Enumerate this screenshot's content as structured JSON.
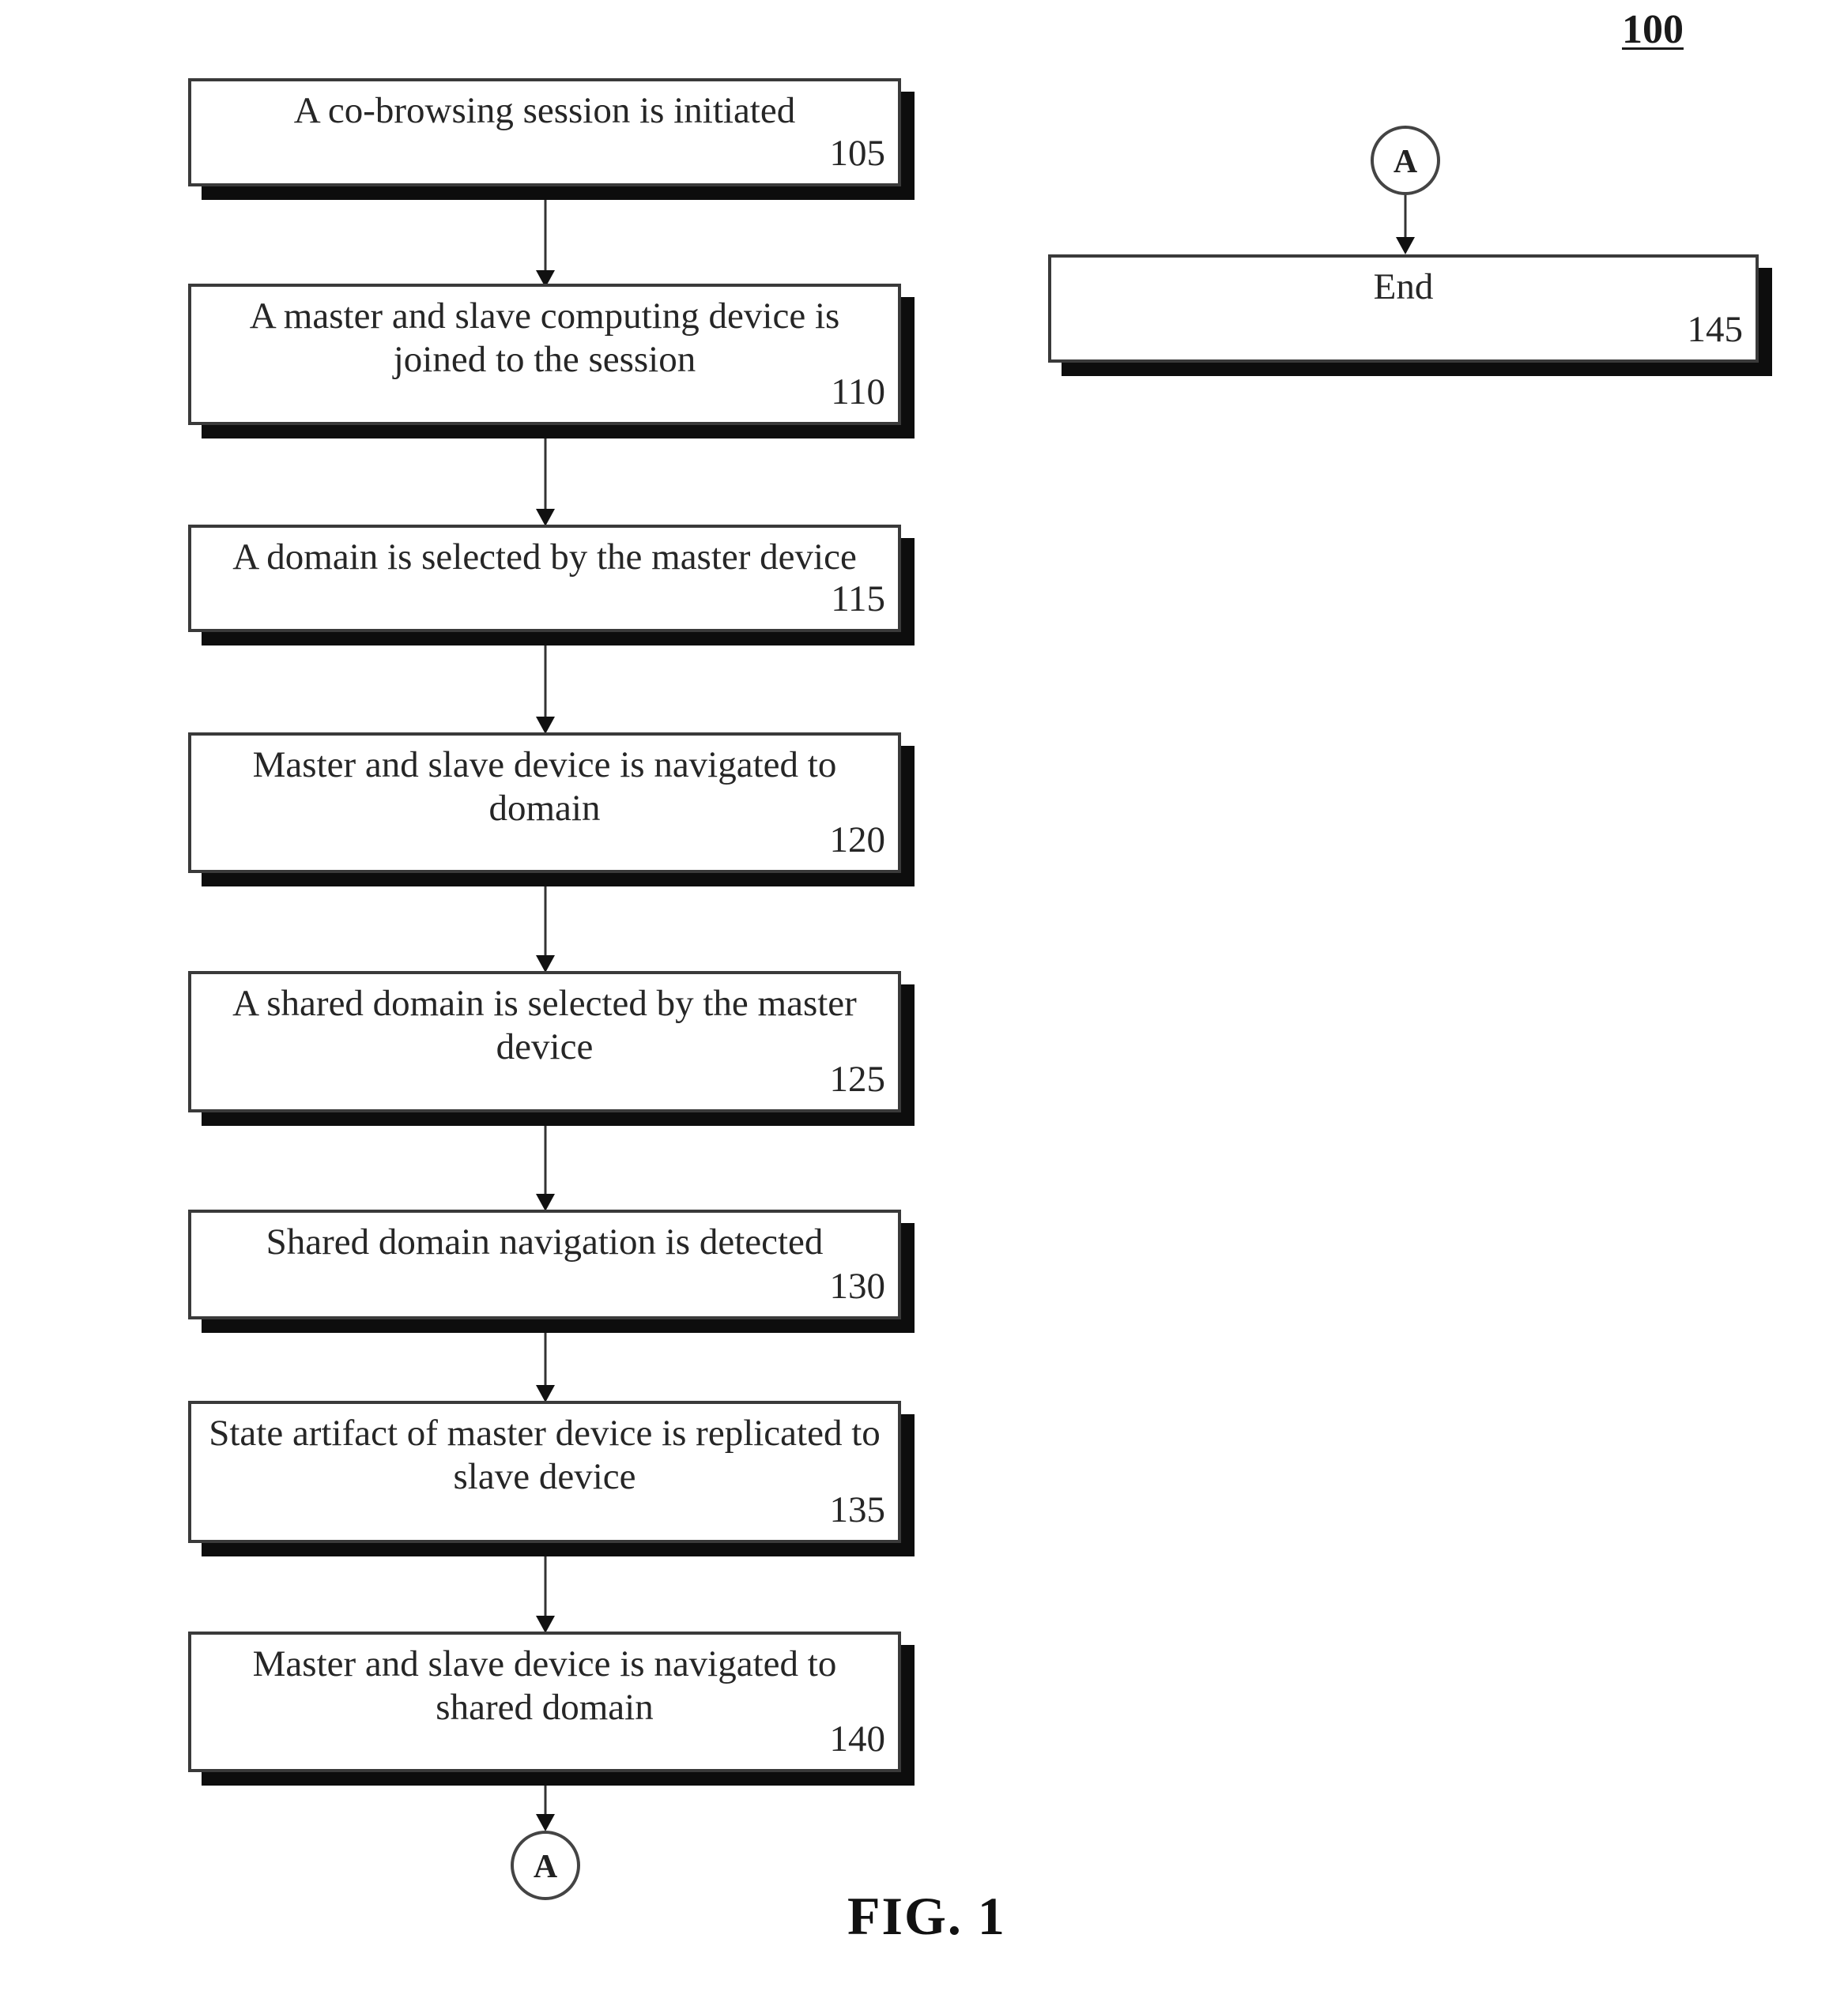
{
  "figure": {
    "reference_numeral": "100",
    "caption": "FIG. 1"
  },
  "steps": [
    {
      "id": "105",
      "text": "A co-browsing session is initiated",
      "number": "105"
    },
    {
      "id": "110",
      "text": "A master and slave computing device is joined to the session",
      "number": "110"
    },
    {
      "id": "115",
      "text": "A domain is selected by the master device",
      "number": "115"
    },
    {
      "id": "120",
      "text": "Master and slave device is navigated to domain",
      "number": "120"
    },
    {
      "id": "125",
      "text": "A shared domain is selected by the master device",
      "number": "125"
    },
    {
      "id": "130",
      "text": "Shared domain navigation is detected",
      "number": "130"
    },
    {
      "id": "135",
      "text": "State artifact of master device is replicated to slave device",
      "number": "135"
    },
    {
      "id": "140",
      "text": "Master and slave device is navigated to shared domain",
      "number": "140"
    },
    {
      "id": "145",
      "text": "End",
      "number": "145"
    }
  ],
  "connectors": {
    "bottom": {
      "label": "A"
    },
    "top": {
      "label": "A"
    }
  },
  "flow": [
    [
      "105",
      "110"
    ],
    [
      "110",
      "115"
    ],
    [
      "115",
      "120"
    ],
    [
      "120",
      "125"
    ],
    [
      "125",
      "130"
    ],
    [
      "130",
      "135"
    ],
    [
      "135",
      "140"
    ],
    [
      "140",
      "connector-A-bottom"
    ],
    [
      "connector-A-top",
      "145"
    ]
  ]
}
